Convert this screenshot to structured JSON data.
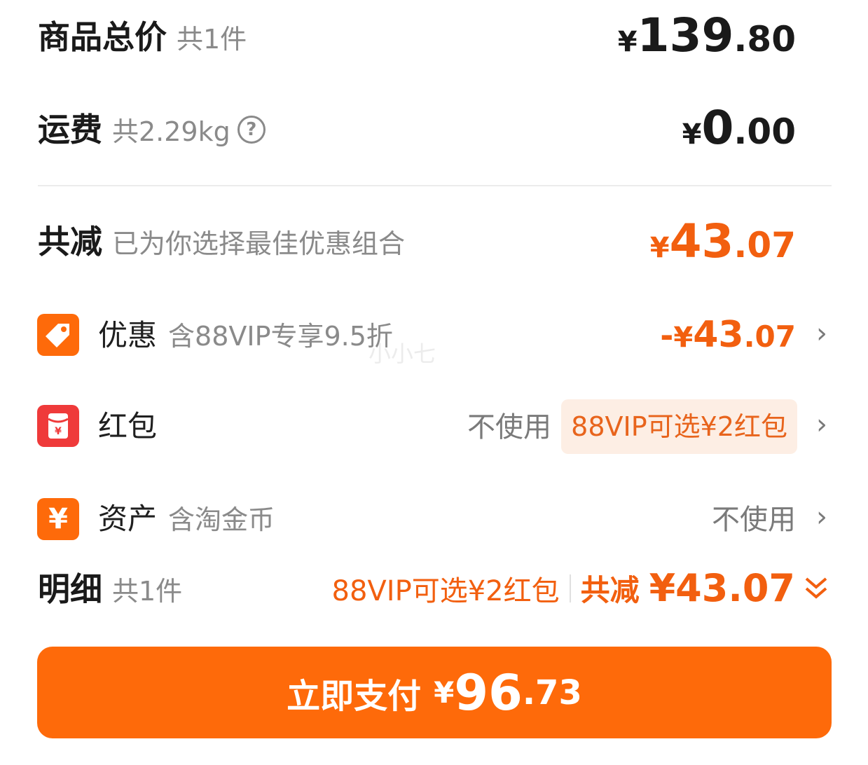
{
  "goods_total": {
    "title": "商品总价",
    "sub": "共1件",
    "currency": "¥",
    "int": "139",
    "dec": ".80"
  },
  "shipping": {
    "title": "运费",
    "sub": "共2.29kg",
    "help": "?",
    "currency": "¥",
    "int": "0",
    "dec": ".00"
  },
  "reduction": {
    "title": "共减",
    "sub": "已为你选择最佳优惠组合",
    "currency": "¥",
    "int": "43",
    "dec": ".07",
    "color": "#f25f0f"
  },
  "discount": {
    "label": "优惠",
    "sub": "含88VIP专享9.5折",
    "prefix": "-",
    "currency": "¥",
    "int": "43",
    "dec": ".07",
    "icon": "tag-icon",
    "icon_color": "#fe6a0a"
  },
  "red_packet": {
    "label": "红包",
    "status": "不使用",
    "pill": "88VIP可选¥2红包",
    "icon": "red-packet-icon",
    "icon_color": "#ef3a3a"
  },
  "assets": {
    "label": "资产",
    "sub": "含淘金币",
    "status": "不使用",
    "icon": "yuan-icon",
    "icon_color": "#fe6a0a"
  },
  "detail": {
    "title": "明细",
    "sub": "共1件",
    "promo": "88VIP可选¥2红包",
    "total_label": "共减",
    "total_value": "¥43.07"
  },
  "pay_button": {
    "label": "立即支付",
    "currency": "¥",
    "int": "96",
    "dec": ".73",
    "color": "#fe6a0a"
  },
  "watermark": "小小七",
  "chevron": "›"
}
